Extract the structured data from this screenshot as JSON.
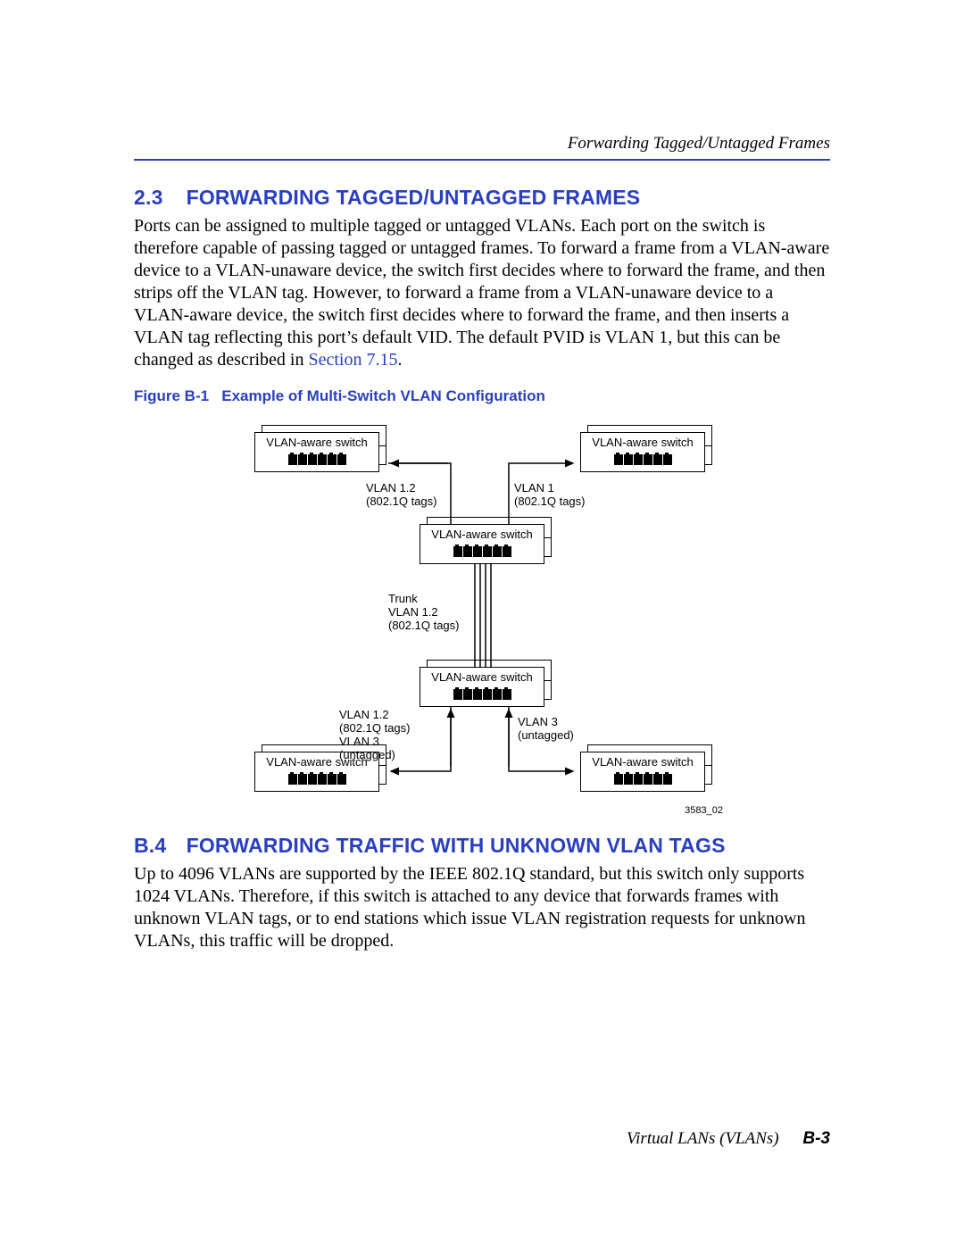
{
  "header": {
    "running_title": "Forwarding Tagged/Untagged Frames"
  },
  "section23": {
    "number": "2.3",
    "title": "FORWARDING TAGGED/UNTAGGED FRAMES",
    "body_a": "Ports can be assigned to multiple tagged or untagged VLANs. Each port on the switch is therefore capable of passing tagged or untagged frames. To forward a frame from a VLAN-aware device to a VLAN-unaware device, the switch first decides where to forward the frame, and then strips off the VLAN tag. However, to forward a frame from a VLAN-unaware device to a VLAN-aware device, the switch first decides where to forward the frame, and then inserts a VLAN tag reflecting this port’s default VID. The default PVID is VLAN 1, but this can be changed as described in ",
    "link_text": "Section 7.15",
    "body_b": "."
  },
  "figure": {
    "caption_label": "Figure B-1",
    "caption_text": "Example of Multi-Switch VLAN Configuration",
    "switch_label": "VLAN-aware switch",
    "id": "3583_02",
    "labels": {
      "top_left": "VLAN 1.2\n(802.1Q tags)",
      "top_right": "VLAN 1\n(802.1Q tags)",
      "trunk": "Trunk\nVLAN 1.2\n(802.1Q tags)",
      "bot_left": "VLAN 1.2\n(802.1Q tags)\nVLAN 3\n(untagged)",
      "bot_right": "VLAN 3\n(untagged)"
    }
  },
  "sectionB4": {
    "number": "B.4",
    "title": "FORWARDING TRAFFIC WITH UNKNOWN VLAN TAGS",
    "body": "Up to 4096 VLANs are supported by the IEEE 802.1Q standard, but this switch only supports 1024 VLANs. Therefore, if this switch is attached to any device that forwards frames with unknown VLAN tags, or to end stations which issue VLAN registration requests for unknown VLANs, this traffic will be dropped."
  },
  "footer": {
    "book": "Virtual LANs (VLANs)",
    "page": "B-3"
  }
}
